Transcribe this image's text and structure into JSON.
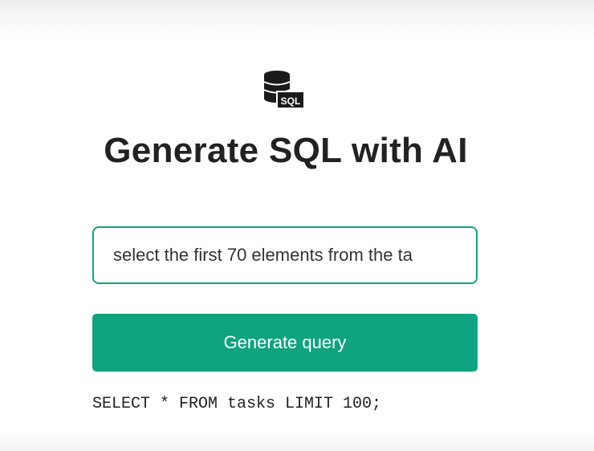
{
  "logo": {
    "icon": "sql-database-icon",
    "badge_text": "SQL"
  },
  "header": {
    "title": "Generate SQL with AI"
  },
  "form": {
    "input_value": "select the first 70 elements from the ta",
    "button_label": "Generate query"
  },
  "result": {
    "query": "SELECT * FROM tasks LIMIT 100;"
  },
  "colors": {
    "accent": "#10a37f",
    "text": "#222222"
  }
}
